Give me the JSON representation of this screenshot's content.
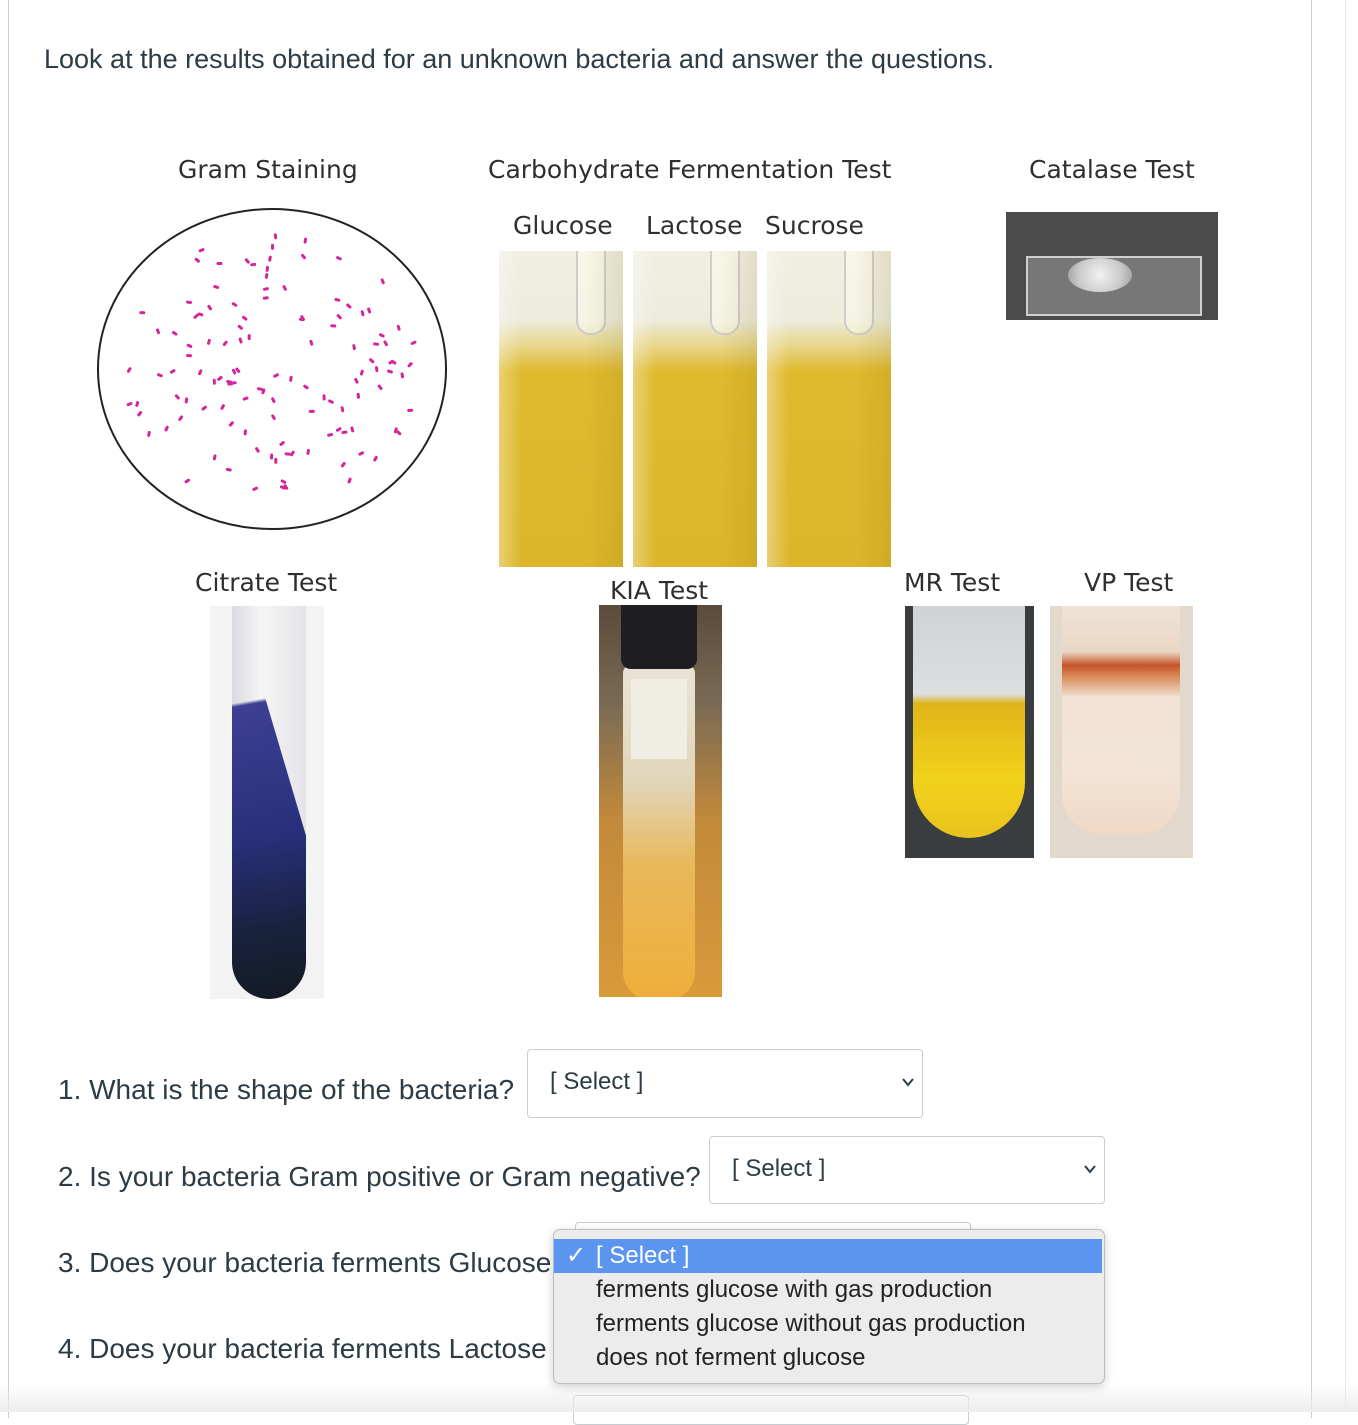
{
  "intro": "Look at the results obtained for an unknown bacteria and answer the questions.",
  "figure": {
    "gram_label": "Gram Staining",
    "carb_title": "Carbohydrate Fermentation Test",
    "glucose_label": "Glucose",
    "lactose_label": "Lactose",
    "sucrose_label": "Sucrose",
    "catalase_label": "Catalase Test",
    "citrate_label": "Citrate Test",
    "kia_label": "KIA Test",
    "mr_label": "MR Test",
    "vp_label": "VP Test"
  },
  "questions": [
    {
      "text": "1. What is the shape of the bacteria?",
      "select_value": "[ Select ]"
    },
    {
      "text": "2. Is your bacteria Gram positive or Gram negative?",
      "select_value": "[ Select ]"
    },
    {
      "text": "3. Does your bacteria ferments Glucose"
    },
    {
      "text": "4. Does your bacteria ferments Lactose"
    }
  ],
  "dropdown": {
    "check": "✓",
    "options": [
      "[ Select ]",
      "ferments glucose with gas production",
      "ferments glucose without gas production",
      "does not ferment glucose"
    ],
    "selected_color": "#5b95f0"
  }
}
